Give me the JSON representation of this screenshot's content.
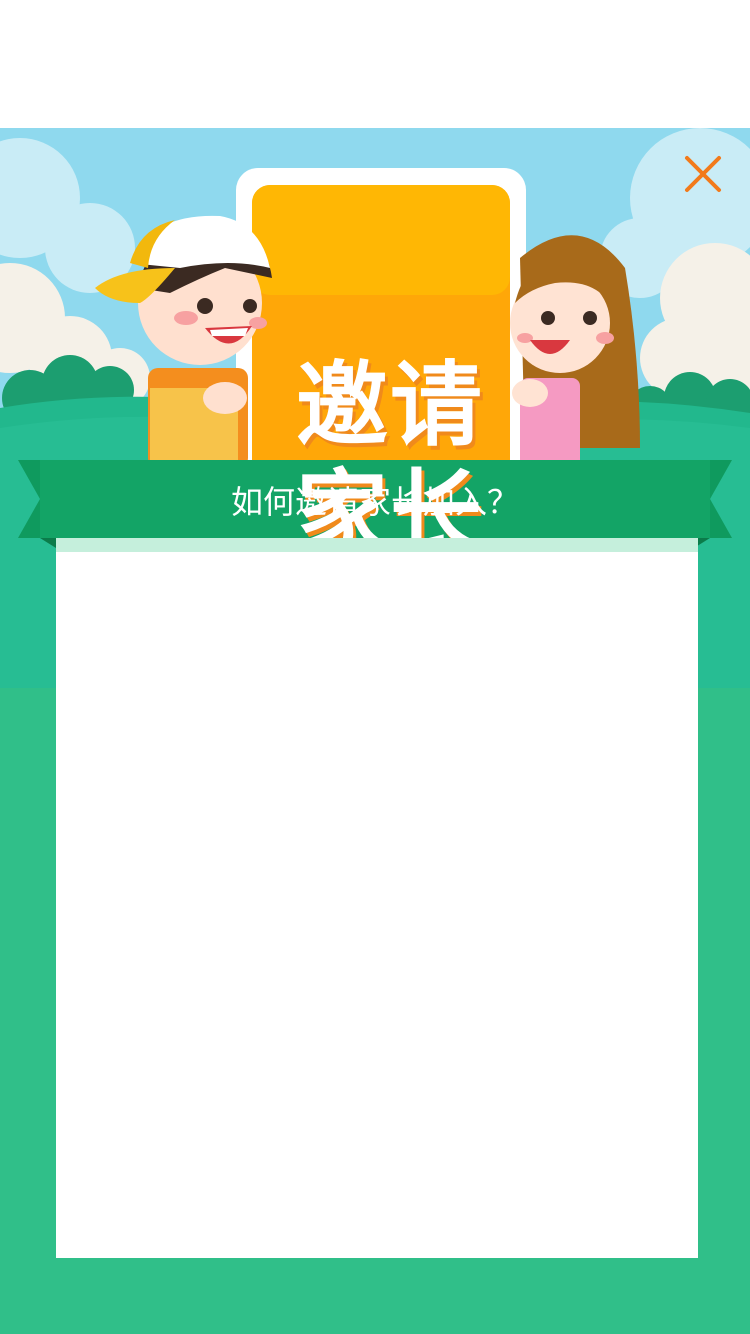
{
  "colors": {
    "sky": "#8fd9ee",
    "hill_green": "#22b88d",
    "ribbon_green": "#13a466",
    "background_green": "#30bf89",
    "card_orange": "#ffa708",
    "close_orange": "#f27a1a"
  },
  "banner": {
    "title_line1": "邀请",
    "title_line2": "家长",
    "ribbon_text": "如何邀请家长加入？"
  },
  "close": {
    "icon": "close-icon"
  },
  "illustration": {
    "left_character": "boy-with-cap",
    "right_character": "girl-with-long-hair"
  }
}
